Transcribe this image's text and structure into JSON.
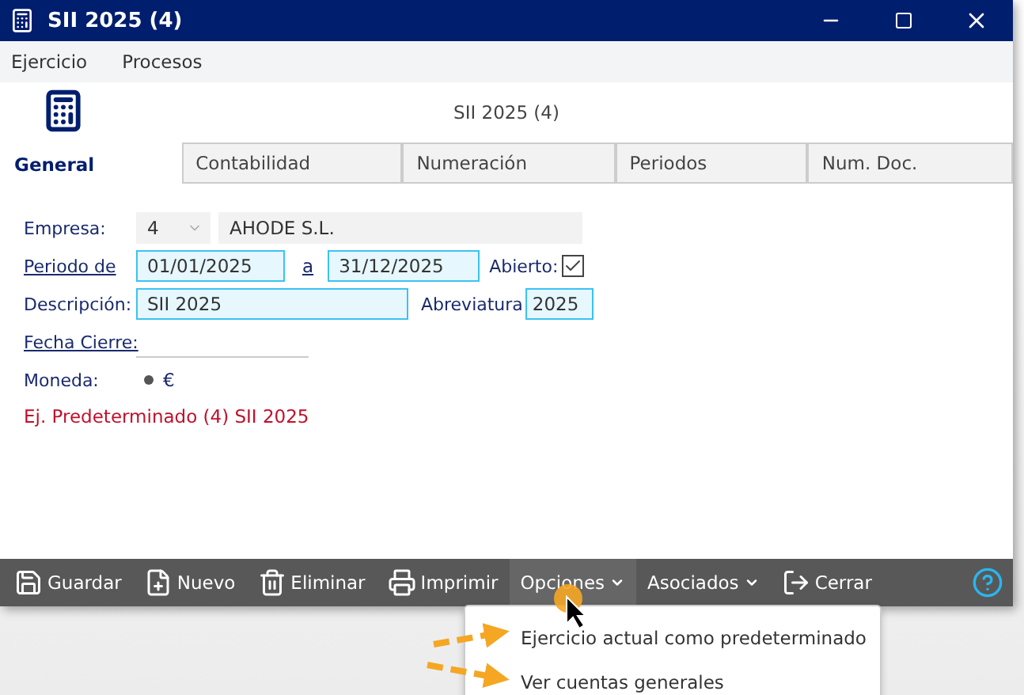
{
  "window": {
    "title": "SII 2025 (4)"
  },
  "menu": [
    "Ejercicio",
    "Procesos"
  ],
  "header": {
    "title": "SII 2025 (4)"
  },
  "tabs": [
    {
      "label": "General",
      "selected": true
    },
    {
      "label": "Contabilidad",
      "selected": false
    },
    {
      "label": "Numeración",
      "selected": false
    },
    {
      "label": "Periodos",
      "selected": false
    },
    {
      "label": "Num. Doc.",
      "selected": false
    }
  ],
  "form": {
    "empresa": {
      "label": "Empresa:",
      "code": "4",
      "name": "AHODE S.L."
    },
    "periodo": {
      "label": "Periodo de",
      "from": "01/01/2025",
      "separator": "a",
      "to": "31/12/2025",
      "open_label": "Abierto:",
      "open": true
    },
    "descripcion": {
      "label": "Descripción:",
      "value": "SII 2025",
      "abbr_label": "Abreviatura",
      "abbr_value": "2025"
    },
    "fecha_cierre": {
      "label": "Fecha Cierre:"
    },
    "moneda": {
      "label": "Moneda:",
      "symbol": "€"
    },
    "note": "Ej. Predeterminado (4) SII 2025"
  },
  "toolbar": [
    {
      "kind": "save",
      "label": "Guardar",
      "has_menu": false,
      "selected": false
    },
    {
      "kind": "new",
      "label": "Nuevo",
      "has_menu": false,
      "selected": false
    },
    {
      "kind": "delete",
      "label": "Eliminar",
      "has_menu": false,
      "selected": false
    },
    {
      "kind": "print",
      "label": "Imprimir",
      "has_menu": false,
      "selected": false
    },
    {
      "kind": "text",
      "label": "Opciones",
      "has_menu": true,
      "selected": true
    },
    {
      "kind": "text",
      "label": "Asociados",
      "has_menu": true,
      "selected": false
    },
    {
      "kind": "close",
      "label": "Cerrar",
      "has_menu": false,
      "selected": false
    }
  ],
  "dropdown": [
    "Ejercicio actual como predeterminado",
    "Ver cuentas generales"
  ]
}
